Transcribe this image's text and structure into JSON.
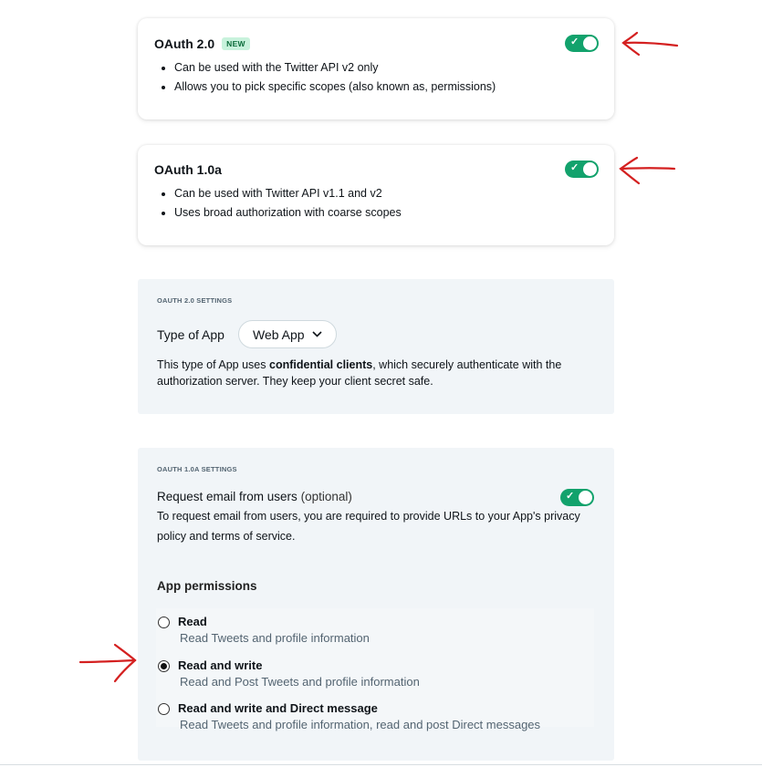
{
  "oauth2": {
    "title": "OAuth 2.0",
    "badge": "NEW",
    "enabled": true,
    "bullets": [
      "Can be used with the Twitter API v2 only",
      "Allows you to pick specific scopes (also known as, permissions)"
    ]
  },
  "oauth1": {
    "title": "OAuth 1.0a",
    "enabled": true,
    "bullets": [
      "Can be used with Twitter API v1.1 and v2",
      "Uses broad authorization with coarse scopes"
    ]
  },
  "oauth2_settings": {
    "section_label": "OAUTH 2.0 SETTINGS",
    "type_label": "Type of App",
    "type_value": "Web App",
    "desc_prefix": "This type of App uses ",
    "desc_bold": "confidential clients",
    "desc_suffix": ", which securely authenticate with the authorization server. They keep your client secret safe."
  },
  "oauth1_settings": {
    "section_label": "OAUTH 1.0A SETTINGS",
    "email_label": "Request email from users",
    "email_optional": "(optional)",
    "email_enabled": true,
    "email_desc": "To request email from users, you are required to provide URLs to your App's privacy policy and terms of service.",
    "permissions_label": "App permissions",
    "options": [
      {
        "title": "Read",
        "desc": "Read Tweets and profile information",
        "checked": false
      },
      {
        "title": "Read and write",
        "desc": "Read and Post Tweets and profile information",
        "checked": true
      },
      {
        "title": "Read and write and Direct message",
        "desc": "Read Tweets and profile information, read and post Direct messages",
        "checked": false
      }
    ]
  },
  "colors": {
    "toggle_on": "#12a26c",
    "annotation_arrow": "#d42020",
    "panel_bg": "#f1f5f8"
  }
}
